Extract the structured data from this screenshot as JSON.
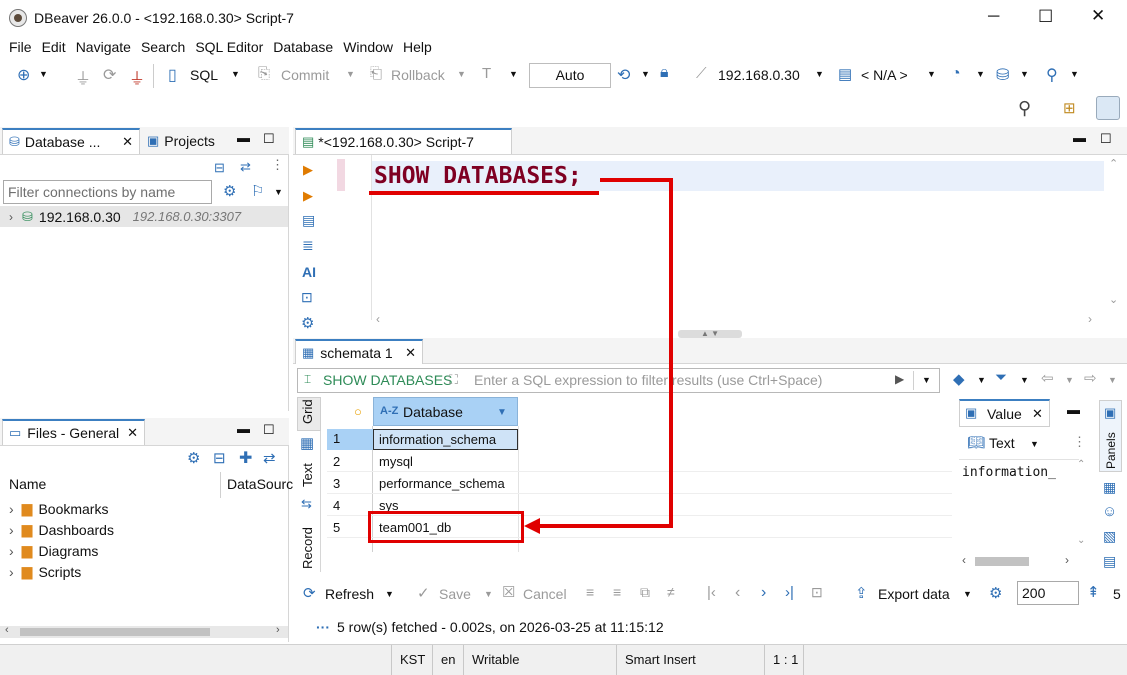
{
  "window": {
    "title": "DBeaver 26.0.0 - <192.168.0.30> Script-7",
    "controls": [
      "─",
      "☐",
      "✕"
    ]
  },
  "menu": [
    "File",
    "Edit",
    "Navigate",
    "Search",
    "SQL Editor",
    "Database",
    "Window",
    "Help"
  ],
  "toolbar": {
    "sql_label": "SQL",
    "commit_label": "Commit",
    "rollback_label": "Rollback",
    "tx_mode": "Auto",
    "connection": "192.168.0.30",
    "schema": "< N/A >"
  },
  "left_panel": {
    "tabs": [
      "Database ...",
      "Projects"
    ],
    "filter_placeholder": "Filter connections by name",
    "connection": {
      "name": "192.168.0.30",
      "address": "192.168.0.30:3307"
    },
    "files": {
      "tab": "Files - General",
      "columns": [
        "Name",
        "DataSourc"
      ],
      "items": [
        "Bookmarks",
        "Dashboards",
        "Diagrams",
        "Scripts"
      ]
    }
  },
  "editor": {
    "tab": "*<192.168.0.30> Script-7",
    "sql": "SHOW DATABASES;",
    "side_ai": "AI"
  },
  "results": {
    "tab": "schemata 1",
    "filter_query": "SHOW DATABASES",
    "filter_placeholder": "Enter a SQL expression to filter results (use Ctrl+Space)",
    "side_tabs": [
      "Grid",
      "Text",
      "Record"
    ],
    "column": "Database",
    "rows": [
      {
        "num": "1",
        "value": "information_schema"
      },
      {
        "num": "2",
        "value": "mysql"
      },
      {
        "num": "3",
        "value": "performance_schema"
      },
      {
        "num": "4",
        "value": "sys"
      },
      {
        "num": "5",
        "value": "team001_db"
      }
    ],
    "value_panel": {
      "tab": "Value",
      "mode": "Text",
      "content": "information_",
      "panels_label": "Panels"
    },
    "bottom": {
      "refresh": "Refresh",
      "save": "Save",
      "cancel": "Cancel",
      "export": "Export data",
      "limit": "200",
      "count": "5"
    },
    "status": "5 row(s) fetched - 0.002s, on 2026-03-25 at 11:15:12"
  },
  "statusbar": {
    "tz": "KST",
    "lang": "en",
    "mode": "Writable",
    "insert": "Smart Insert",
    "pos": "1 : 1"
  },
  "colors": {
    "accent": "#3c7fc1",
    "sql_keyword": "#7f0022",
    "annotation": "#e00000",
    "selection": "#cfe3f7"
  }
}
